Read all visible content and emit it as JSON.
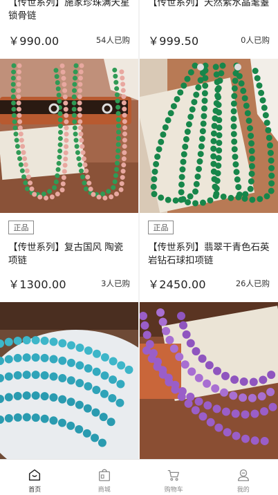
{
  "products": [
    {
      "title": "【传世系列】施家珍珠满天星锁骨链",
      "price": "￥990.00",
      "sold": "54人已购"
    },
    {
      "title": "【传世系列】天然紫水晶耄耋",
      "price": "￥999.50",
      "sold": "0人已购"
    },
    {
      "tag": "正品",
      "title": "【传世系列】复古国风 陶瓷项链",
      "price": "￥1300.00",
      "sold": "3人已购"
    },
    {
      "tag": "正品",
      "title": "【传世系列】翡翠干青色石英岩钻石球扣项链",
      "price": "￥2450.00",
      "sold": "26人已购"
    }
  ],
  "images": {
    "p3": "ceramic-bead-necklace-photo",
    "p4": "green-jade-necklace-photo",
    "p5": "blue-bead-necklace-photo",
    "p6": "amethyst-necklace-photo"
  },
  "tabbar": {
    "items": [
      {
        "label": "首页",
        "icon": "home-icon",
        "active": true
      },
      {
        "label": "商城",
        "icon": "shop-icon",
        "active": false
      },
      {
        "label": "购物车",
        "icon": "cart-icon",
        "active": false
      },
      {
        "label": "我的",
        "icon": "profile-icon",
        "active": false
      }
    ]
  }
}
